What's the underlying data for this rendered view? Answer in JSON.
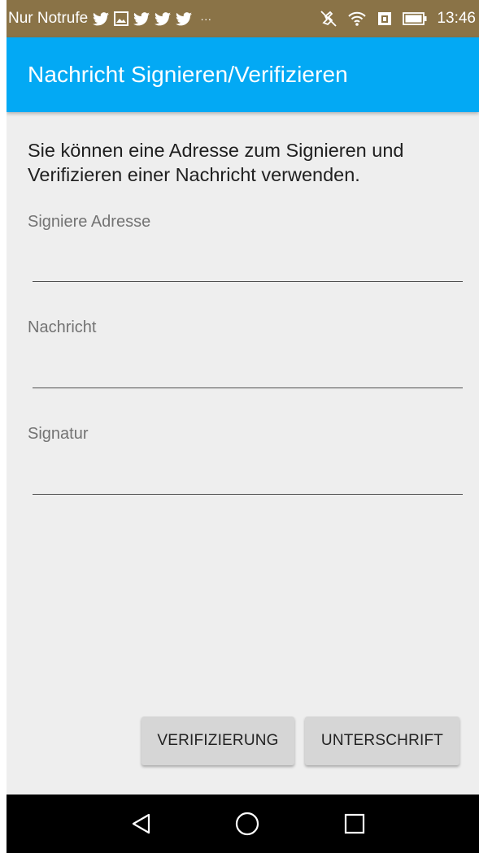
{
  "status_bar": {
    "carrier": "Nur Notrufe",
    "overflow": "···",
    "time": "13:46",
    "left_icons": [
      "twitter-icon",
      "image-icon",
      "twitter-icon",
      "twitter-icon",
      "twitter-icon"
    ],
    "right_icons": [
      "mute-icon",
      "wifi-icon",
      "sim-icon",
      "battery-icon"
    ]
  },
  "app_bar": {
    "title": "Nachricht Signieren/Verifizieren"
  },
  "form": {
    "intro": "Sie können eine Adresse zum Signieren und Verifizieren einer Nachricht verwenden.",
    "address_label": "Signiere Adresse",
    "address_value": "",
    "message_label": "Nachricht",
    "message_value": "",
    "signature_label": "Signatur",
    "signature_value": ""
  },
  "buttons": {
    "verify_label": "VERIFIZIERUNG",
    "sign_label": "UNTERSCHRIFT"
  },
  "nav_bar": {
    "icons": [
      "back-icon",
      "home-icon",
      "recents-icon"
    ]
  },
  "colors": {
    "status_bar": "#8a7347",
    "app_bar": "#03a9f4",
    "background": "#eeeeee",
    "button": "#d6d6d6"
  }
}
